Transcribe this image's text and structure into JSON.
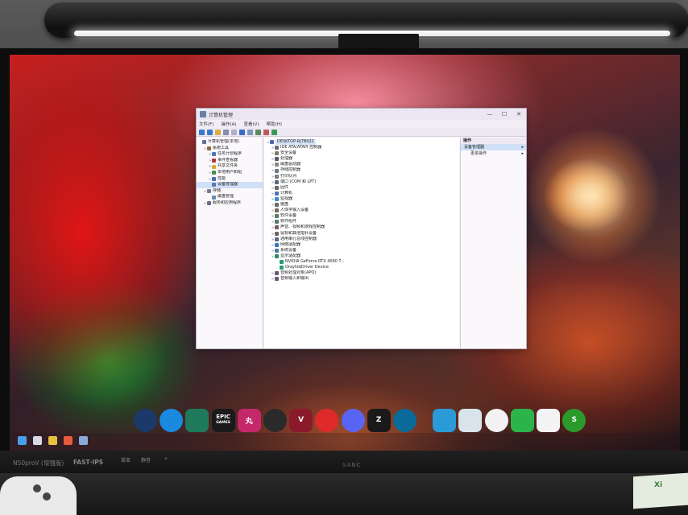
{
  "window": {
    "title": "计算机管理",
    "menu": [
      "文件(F)",
      "操作(A)",
      "查看(V)",
      "帮助(H)"
    ],
    "controls": {
      "minimize": "—",
      "maximize": "☐",
      "close": "✕"
    }
  },
  "left_tree": [
    {
      "indent": 0,
      "twisty": "",
      "label": "计算机管理(本地)",
      "icon_color": "#5a6f9a",
      "selected": false
    },
    {
      "indent": 1,
      "twisty": "v",
      "label": "系统工具",
      "icon_color": "#8a6d3a",
      "selected": false
    },
    {
      "indent": 2,
      "twisty": ">",
      "label": "任务计划程序",
      "icon_color": "#4a7ab5",
      "selected": false
    },
    {
      "indent": 2,
      "twisty": ">",
      "label": "事件查看器",
      "icon_color": "#b33a3a",
      "selected": false
    },
    {
      "indent": 2,
      "twisty": ">",
      "label": "共享文件夹",
      "icon_color": "#d8a83a",
      "selected": false
    },
    {
      "indent": 2,
      "twisty": ">",
      "label": "本地用户和组",
      "icon_color": "#4a8a4a",
      "selected": false
    },
    {
      "indent": 2,
      "twisty": ">",
      "label": "性能",
      "icon_color": "#4a6ab5",
      "selected": false
    },
    {
      "indent": 2,
      "twisty": "",
      "label": "设备管理器",
      "icon_color": "#5a7ab0",
      "selected": true
    },
    {
      "indent": 1,
      "twisty": "v",
      "label": "存储",
      "icon_color": "#7a7a8a",
      "selected": false
    },
    {
      "indent": 2,
      "twisty": "",
      "label": "磁盘管理",
      "icon_color": "#6a8aaa",
      "selected": false
    },
    {
      "indent": 1,
      "twisty": ">",
      "label": "服务和应用程序",
      "icon_color": "#6a6a8a",
      "selected": false
    }
  ],
  "device_tree": [
    {
      "indent": 0,
      "twisty": "v",
      "label": "DESKTOP-RJ7B02C",
      "icon_color": "#4a6ab5",
      "root": true
    },
    {
      "indent": 1,
      "twisty": ">",
      "label": "IDE ATA/ATAPI 控制器",
      "icon_color": "#6a6a7a"
    },
    {
      "indent": 1,
      "twisty": ">",
      "label": "安全设备",
      "icon_color": "#7a7a6a"
    },
    {
      "indent": 1,
      "twisty": ">",
      "label": "处理器",
      "icon_color": "#5a5a6a"
    },
    {
      "indent": 1,
      "twisty": ">",
      "label": "磁盘驱动器",
      "icon_color": "#8a8a8a"
    },
    {
      "indent": 1,
      "twisty": ">",
      "label": "存储控制器",
      "icon_color": "#6a7a8a"
    },
    {
      "indent": 1,
      "twisty": ">",
      "label": "打印队列",
      "icon_color": "#7a7a7a"
    },
    {
      "indent": 1,
      "twisty": ">",
      "label": "端口 (COM 和 LPT)",
      "icon_color": "#5a6a7a"
    },
    {
      "indent": 1,
      "twisty": ">",
      "label": "固件",
      "icon_color": "#6a6a6a"
    },
    {
      "indent": 1,
      "twisty": ">",
      "label": "计算机",
      "icon_color": "#4a7ab5"
    },
    {
      "indent": 1,
      "twisty": ">",
      "label": "监视器",
      "icon_color": "#3a8ac5"
    },
    {
      "indent": 1,
      "twisty": ">",
      "label": "键盘",
      "icon_color": "#6a6a6a"
    },
    {
      "indent": 1,
      "twisty": ">",
      "label": "人体学输入设备",
      "icon_color": "#7a6a5a"
    },
    {
      "indent": 1,
      "twisty": ">",
      "label": "软件设备",
      "icon_color": "#5a7a6a"
    },
    {
      "indent": 1,
      "twisty": ">",
      "label": "软件组件",
      "icon_color": "#5a7a6a"
    },
    {
      "indent": 1,
      "twisty": ">",
      "label": "声音、视频和游戏控制器",
      "icon_color": "#7a5a6a"
    },
    {
      "indent": 1,
      "twisty": ">",
      "label": "鼠标和其他指针设备",
      "icon_color": "#6a6a6a"
    },
    {
      "indent": 1,
      "twisty": ">",
      "label": "通用串行总线控制器",
      "icon_color": "#5a6a8a"
    },
    {
      "indent": 1,
      "twisty": ">",
      "label": "网络适配器",
      "icon_color": "#3a7ab5"
    },
    {
      "indent": 1,
      "twisty": ">",
      "label": "系统设备",
      "icon_color": "#4a7a9a"
    },
    {
      "indent": 1,
      "twisty": "v",
      "label": "显示适配器",
      "icon_color": "#2a8a6a"
    },
    {
      "indent": 2,
      "twisty": "",
      "label": "NVIDIA GeForce RTX 4060 T...",
      "icon_color": "#2a9a6a"
    },
    {
      "indent": 2,
      "twisty": "",
      "label": "OrayIddDriver Device",
      "icon_color": "#2a9a6a"
    },
    {
      "indent": 1,
      "twisty": ">",
      "label": "音频处理对象(APO)",
      "icon_color": "#6a5a7a"
    },
    {
      "indent": 1,
      "twisty": ">",
      "label": "音频输入和输出",
      "icon_color": "#6a5a7a"
    }
  ],
  "actions": {
    "header": "操作",
    "selected_item": "设备管理器",
    "more": "更多操作",
    "arrow": "▸"
  },
  "dock": [
    {
      "name": "steam-icon",
      "label": "",
      "bg": "#1b3a6a"
    },
    {
      "name": "battlenet-icon",
      "label": "",
      "bg": "#1a8ae0"
    },
    {
      "name": "maestro-icon",
      "label": "",
      "bg": "#1e7a5a"
    },
    {
      "name": "epic-games-icon",
      "label": "EPIC",
      "bg": "#1a1a1a"
    },
    {
      "name": "mihoyo-icon",
      "label": "丸",
      "bg": "#c4286a"
    },
    {
      "name": "obs-icon",
      "label": "",
      "bg": "#2a2a2a"
    },
    {
      "name": "valorant-icon",
      "label": "V",
      "bg": "#8a1a2a"
    },
    {
      "name": "fist-icon",
      "label": "",
      "bg": "#e02a2a"
    },
    {
      "name": "discord-icon",
      "label": "",
      "bg": "#5865f2"
    },
    {
      "name": "z-app-icon",
      "label": "Z",
      "bg": "#1a1a1a"
    },
    {
      "name": "sync-app-icon",
      "label": "",
      "bg": "#0a6a9a"
    },
    {
      "name": "desktop-icon",
      "label": "",
      "bg": "#2a9ad8"
    },
    {
      "name": "recycle-bin-icon",
      "label": "",
      "bg": "#d8e4ea"
    },
    {
      "name": "chrome-icon",
      "label": "",
      "bg": "#f2f2f2"
    },
    {
      "name": "wechat-icon",
      "label": "",
      "bg": "#2ab44a"
    },
    {
      "name": "qq-icon",
      "label": "",
      "bg": "#f4f4f4"
    },
    {
      "name": "music-app-icon",
      "label": "S",
      "bg": "#2a9a2a"
    }
  ],
  "epic_sub": "GAMES",
  "taskbar": [
    {
      "name": "start-icon",
      "bg": "#4aa0e8"
    },
    {
      "name": "task-view-icon",
      "bg": "#d8d8e8"
    },
    {
      "name": "file-explorer-icon",
      "bg": "#e8c040"
    },
    {
      "name": "taskbar-chrome-icon",
      "bg": "#e85a3a"
    },
    {
      "name": "taskbar-computer-management-icon",
      "bg": "#8aa8d8"
    }
  ],
  "monitor": {
    "model": "N50proV (增强版)",
    "panel": "FAST·IPS",
    "brand": "SANC",
    "buttons": [
      "菜单",
      "静音",
      "+"
    ]
  },
  "desk_box_text": "Xi"
}
